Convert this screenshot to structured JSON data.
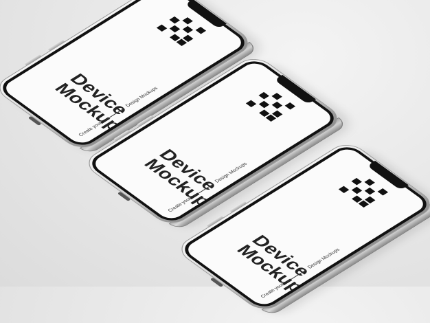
{
  "mockup": {
    "title_line1": "Device",
    "title_line2": "Mockups",
    "tagline_left": "Create your",
    "tagline_right": "Design Mockups"
  },
  "colors": {
    "background": "#e9e9e9",
    "frame": "#cfcfcf",
    "screen": "#fbfbfb",
    "ink": "#111111"
  },
  "icons": [
    "pixel-logo-icon"
  ]
}
